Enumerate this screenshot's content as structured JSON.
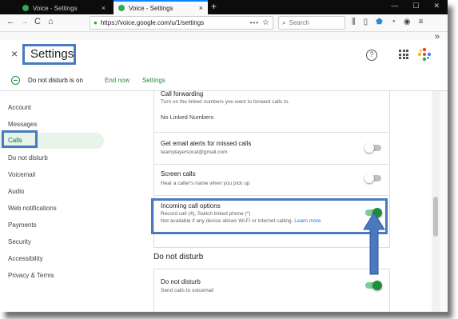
{
  "browser": {
    "tabs": [
      {
        "label": "Voice - Settings",
        "close": "×"
      },
      {
        "label": "Voice - Settings",
        "close": "×"
      }
    ],
    "new_tab": "+",
    "window_controls": [
      "—",
      "☐",
      "✕"
    ],
    "back": "←",
    "forward": "→",
    "reload": "C",
    "home": "⌂",
    "url": "https://voice.google.com/u/1/settings",
    "url_menu": "•••",
    "bookmark": "☆",
    "search_placeholder": "Search",
    "overflow": "»"
  },
  "header": {
    "close": "×",
    "title": "Settings",
    "help": "?"
  },
  "dnd_banner": {
    "status": "Do not disturb is on",
    "end_now": "End now",
    "settings": "Settings"
  },
  "sidebar": {
    "items": [
      {
        "label": "Account"
      },
      {
        "label": "Messages"
      },
      {
        "label": "Calls"
      },
      {
        "label": "Do not disturb"
      },
      {
        "label": "Voicemail"
      },
      {
        "label": "Audio"
      },
      {
        "label": "Web notifications"
      },
      {
        "label": "Payments"
      },
      {
        "label": "Security"
      },
      {
        "label": "Accessibility"
      },
      {
        "label": "Privacy & Terms"
      }
    ]
  },
  "calls": {
    "forwarding": {
      "title": "Call forwarding",
      "subtitle": "Turn on the linked numbers you want to forward calls to.",
      "empty": "No Linked Numbers"
    },
    "missed_alerts": {
      "title": "Get email alerts for missed calls",
      "subtitle": "teamplayersocal@gmail.com",
      "enabled": false
    },
    "screen_calls": {
      "title": "Screen calls",
      "subtitle": "Hear a caller's name when you pick up",
      "enabled": false
    },
    "incoming_options": {
      "title": "Incoming call options",
      "subtitle1": "Record call (4), Switch linked phone (*)",
      "subtitle2": "Not available if any device allows Wi-Fi or internet calling.",
      "learn_more": "Learn more",
      "enabled": true
    }
  },
  "dnd_section": {
    "heading": "Do not disturb",
    "title": "Do not disturb",
    "subtitle": "Send calls to voicemail",
    "enabled": true
  },
  "colors": {
    "accent_green": "#1e8e3e",
    "highlight_blue": "#4a79c0",
    "link_blue": "#1a73e8"
  }
}
